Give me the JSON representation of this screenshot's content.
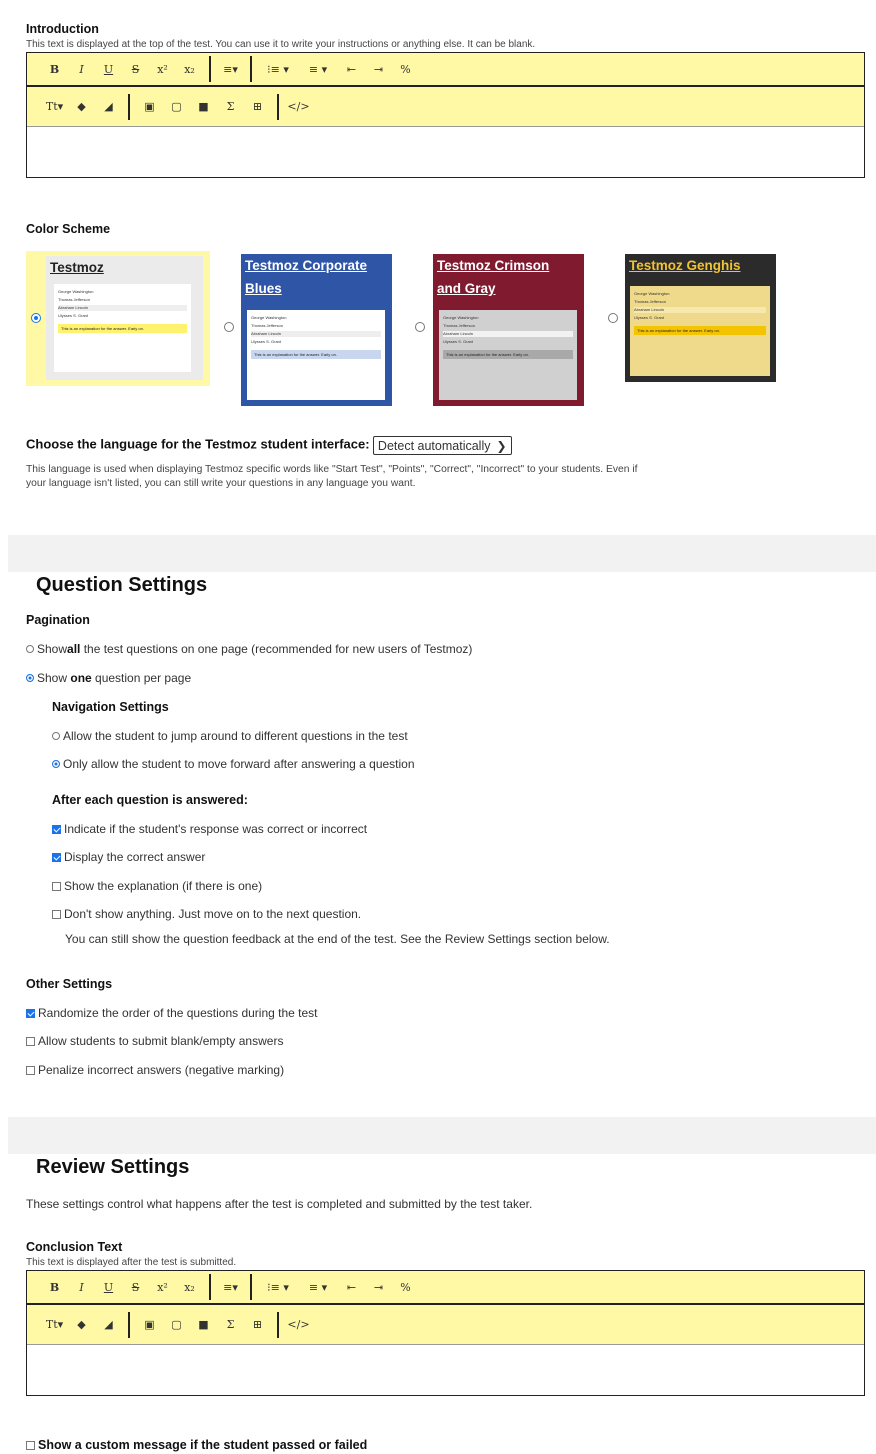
{
  "introduction": {
    "heading": "Introduction",
    "hint": "This text is displayed at the top of the test. You can use it to write your instructions or anything else. It can be blank."
  },
  "toolbar": {
    "row1": [
      "B",
      "I",
      "U",
      "S",
      "x²",
      "x₂",
      "≡▾",
      "⁝≡ ▾",
      "≡ ▾",
      "⇤",
      "⇥",
      "%"
    ],
    "row2": [
      "Tt▾",
      "◆",
      "◢",
      "▣",
      "▢",
      "■",
      "Σ",
      "⊞",
      "</>"
    ]
  },
  "color_scheme": {
    "heading": "Color Scheme",
    "schemes": [
      {
        "title": "Testmoz",
        "selected": true,
        "bg": "#fff9a6",
        "title_color": "#222",
        "inner_bg": "#ebebeb"
      },
      {
        "title": "Testmoz Corporate Blues",
        "selected": false,
        "bg": "#2f55a6",
        "title_color": "#ffffff",
        "inner_bg": "#ffffff"
      },
      {
        "title": "Testmoz Crimson and Gray",
        "selected": false,
        "bg": "#7f1a2f",
        "title_color": "#ffffff",
        "inner_bg": "#d0d0d0"
      },
      {
        "title": "Testmoz Genghis",
        "selected": false,
        "bg": "#2b2b2b",
        "title_color": "#f1c232",
        "inner_bg": "#efd98a"
      }
    ],
    "preview_lines": [
      "George Washington",
      "Thomas Jefferson",
      "Abraham Lincoln",
      "Ulysses S. Grant"
    ],
    "preview_note": "This is an explanation for the answer. Early on."
  },
  "language": {
    "label": "Choose the language for the Testmoz student interface:",
    "value": "Detect automatically",
    "hint_line1": "This language is used when displaying Testmoz specific words like \"Start Test\", \"Points\", \"Correct\", \"Incorrect\" to your students. Even if",
    "hint_line2": "your language isn't listed, you can still write your questions in any language you want."
  },
  "question_settings": {
    "title": "Question Settings",
    "pagination": {
      "heading": "Pagination",
      "opt_all_pre": "Show ",
      "opt_all_bold": "all",
      "opt_all_post": " the test questions on one page (recommended for new users of Testmoz)",
      "opt_one_pre": "Show ",
      "opt_one_bold": "one",
      "opt_one_post": " question per page"
    },
    "navigation": {
      "heading": "Navigation Settings",
      "opt_jump": "Allow the student to jump around to different questions in the test",
      "opt_forward": "Only allow the student to move forward after answering a question"
    },
    "after_answer": {
      "heading": "After each question is answered:",
      "opt_indicate": "Indicate if the student's response was correct or incorrect",
      "opt_display": "Display the correct answer",
      "opt_explanation": "Show the explanation (if there is one)",
      "opt_nothing": "Don't show anything. Just move on to the next question.",
      "note": "You can still show the question feedback at the end of the test. See the Review Settings section below."
    },
    "other": {
      "heading": "Other Settings",
      "opt_randomize": "Randomize the order of the questions during the test",
      "opt_blank": "Allow students to submit blank/empty answers",
      "opt_penalize": "Penalize incorrect answers (negative marking)"
    }
  },
  "review_settings": {
    "title": "Review Settings",
    "desc": "These settings control what happens after the test is completed and submitted by the test taker.",
    "conclusion_heading": "Conclusion Text",
    "conclusion_hint": "This text is displayed after the test is submitted.",
    "custom_message": "Show a custom message if the student passed or failed"
  }
}
